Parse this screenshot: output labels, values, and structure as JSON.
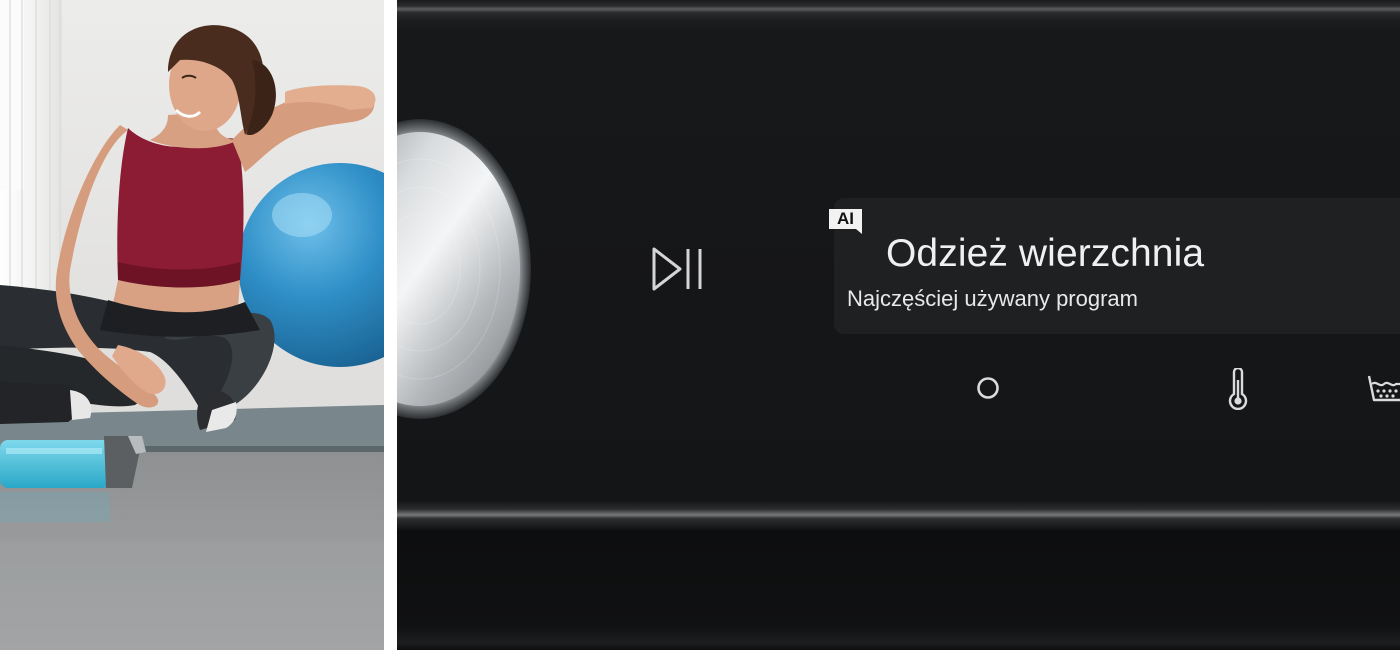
{
  "display": {
    "badge": "AI",
    "program_title": "Odzież wierzchnia",
    "program_subtitle": "Najczęściej używany program"
  },
  "icons": {
    "play_pause": "play-pause-icon",
    "option": "circle-option-icon",
    "temperature": "thermometer-icon",
    "rinse": "rinse-basin-icon"
  },
  "colors": {
    "panel_background": "#151617",
    "display_text": "#eef0f2",
    "program_box": "#1f2022",
    "icon": "#d9dbdd",
    "badge": "#f2f2f2"
  }
}
